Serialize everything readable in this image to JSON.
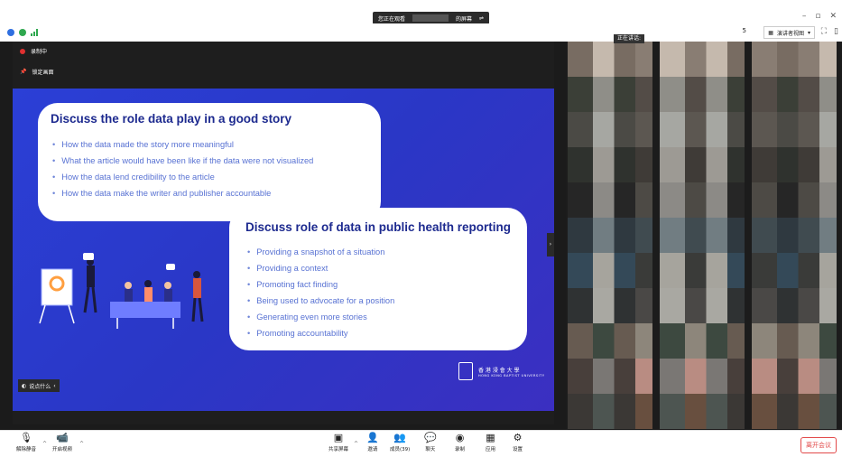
{
  "titlebar": {
    "viewing_label": "您正在观看",
    "screen_label": "的屏幕",
    "window_controls": [
      "–",
      "▫",
      "✕"
    ]
  },
  "topbar": {
    "participants_count_badge": "5",
    "speaker_view_label": "演讲者视图",
    "icons": [
      "info-icon",
      "security-shield-icon",
      "signal-icon"
    ],
    "right_icons": [
      "fullscreen-icon",
      "layout-icon"
    ]
  },
  "status": {
    "recording_label": "录制中",
    "lock_label": "锁定画面"
  },
  "slide": {
    "bubble1": {
      "title": "Discuss the role data play in a good story",
      "items": [
        "How the data made the story more meaningful",
        "What the article would have been like if the data were not visualized",
        "How the data lend credibility to the article",
        "How the data make the writer and publisher accountable"
      ]
    },
    "bubble2": {
      "title": "Discuss role of data in public health reporting",
      "items": [
        "Providing a snapshot of a situation",
        "Providing a context",
        "Promoting fact finding",
        "Being used to advocate for a position",
        "Generating even more stories",
        "Promoting accountability"
      ]
    },
    "logo": {
      "name_zh": "香 港 浸 會 大 學",
      "name_en": "HONG KONG BAPTIST UNIVERSITY"
    },
    "annotate_label": "说点什么"
  },
  "gallery": {
    "speaking_label": "正在讲话:",
    "tile_colors": [
      [
        "#7b6b5f",
        "#c7b9a9",
        "#8b7d70"
      ],
      [
        "#3a3f36",
        "#8f8e86",
        "#544c45"
      ],
      [
        "#4b4a44",
        "#a6a7a1",
        "#5d574f"
      ],
      [
        "#2f322d",
        "#9e9a92",
        "#403b36"
      ],
      [
        "#262626",
        "#8c8a85",
        "#4e4a44"
      ],
      [
        "#2d3942",
        "#6e7e84",
        "#3e4c52"
      ],
      [
        "#2f4a5c",
        "#a7a49b",
        "#3a3b38"
      ],
      [
        "#2f3233",
        "#a9a8a0",
        "#4a4845"
      ],
      [
        "#6a5a4e",
        "#3b4a3f",
        "#8f8678"
      ],
      [
        "#4a3f3a",
        "#7b7773",
        "#c28a7d"
      ],
      [
        "#3c3834",
        "#4c5551",
        "#6d4e3a"
      ]
    ]
  },
  "toolbar": {
    "mute_label": "解除静音",
    "video_label": "开启视频",
    "share_label": "共享屏幕",
    "invite_label": "邀请",
    "members_label": "成员(39)",
    "chat_label": "聊天",
    "record_label": "录制",
    "apps_label": "应用",
    "settings_label": "设置",
    "leave_label": "离开会议"
  }
}
